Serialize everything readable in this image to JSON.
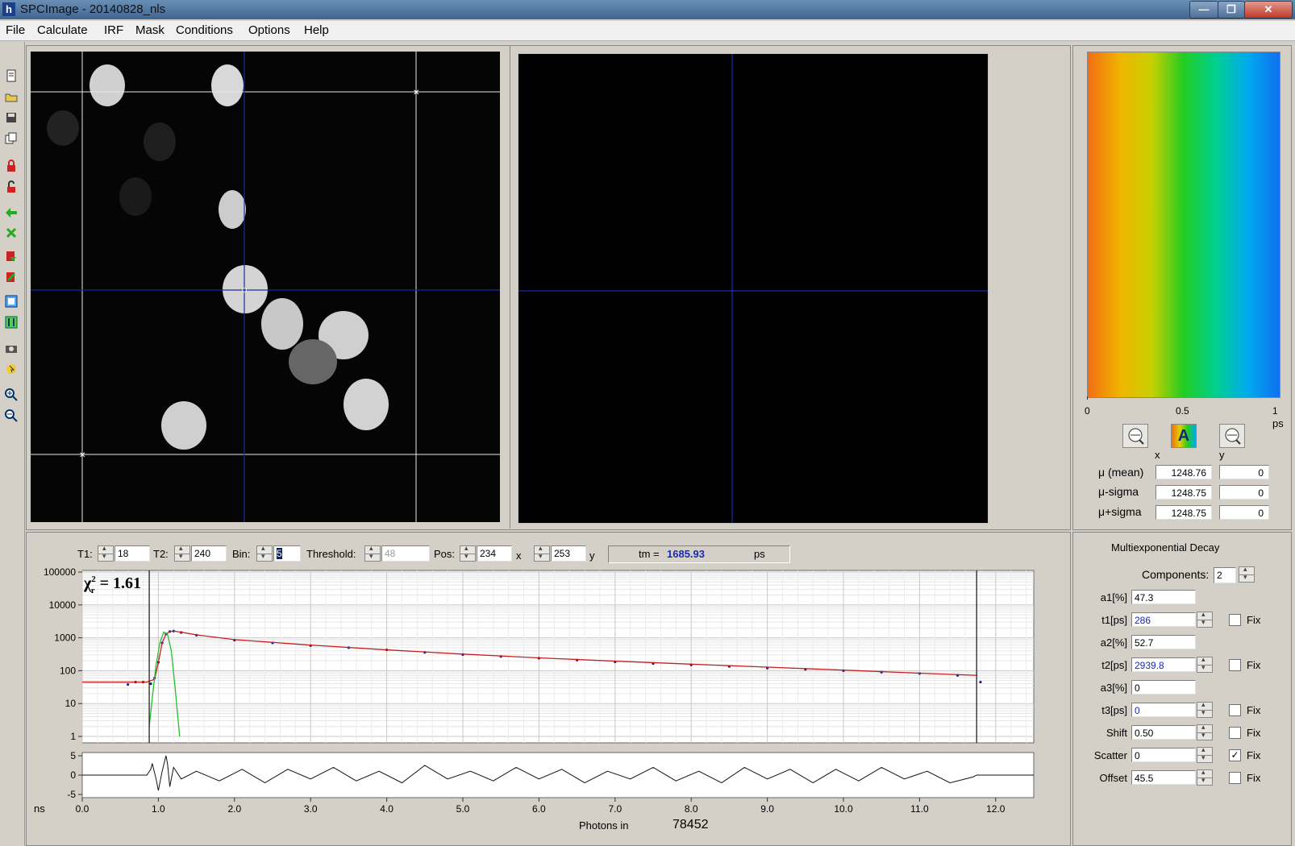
{
  "window": {
    "title": "SPCImage - 20140828_nls",
    "app_icon": "h",
    "minimize": "—",
    "maximize": "❐",
    "close": "✕"
  },
  "menu": [
    "File",
    "Calculate",
    "IRF",
    "Mask",
    "Conditions",
    "Options",
    "Help"
  ],
  "toolbar_icons": [
    "new-icon",
    "open-icon",
    "save-icon",
    "copy-icon",
    "lock-icon",
    "unlock-icon",
    "arrow-left-icon",
    "arrow-down-icon",
    "import-icon",
    "export-icon",
    "frame-icon",
    "bar-icon",
    "camera-icon",
    "pointer-icon",
    "zoom-in-icon",
    "zoom-out-icon"
  ],
  "colorbar": {
    "ticks": [
      "0",
      "0.5",
      "1"
    ],
    "unit": "ps",
    "axis_x": "x",
    "axis_y": "y",
    "auto_label": "A",
    "colors": [
      "#f06e14",
      "#f0b400",
      "#c8d000",
      "#22cc22",
      "#00d090",
      "#00aaee",
      "#1070f0"
    ]
  },
  "stats": {
    "mean_label": "μ (mean)",
    "mean_x": "1248.76",
    "mean_y": "0",
    "minus_label": "μ-sigma",
    "minus_x": "1248.75",
    "minus_y": "0",
    "plus_label": "μ+sigma",
    "plus_x": "1248.75",
    "plus_y": "0"
  },
  "controls": {
    "t1_label": "T1:",
    "t1": "18",
    "t2_label": "T2:",
    "t2": "240",
    "bin_label": "Bin:",
    "bin": "5",
    "threshold_label": "Threshold:",
    "threshold": "48",
    "pos_label": "Pos:",
    "pos_x": "234",
    "x_label": "x",
    "pos_y": "253",
    "y_label": "y",
    "tm_label": "tm =",
    "tm_value": "1685.93",
    "tm_unit": "ps"
  },
  "decay": {
    "title": "Multiexponential Decay",
    "components_label": "Components:",
    "components": "2",
    "fix_label": "Fix",
    "params": [
      {
        "label": "a1[%]",
        "value": "47.3",
        "spin": false,
        "fix": null,
        "blue": false
      },
      {
        "label": "t1[ps]",
        "value": "286",
        "spin": true,
        "fix": false,
        "blue": true
      },
      {
        "label": "a2[%]",
        "value": "52.7",
        "spin": false,
        "fix": null,
        "blue": false
      },
      {
        "label": "t2[ps]",
        "value": "2939.8",
        "spin": true,
        "fix": false,
        "blue": true
      },
      {
        "label": "a3[%]",
        "value": "0",
        "spin": false,
        "fix": null,
        "blue": false
      },
      {
        "label": "t3[ps]",
        "value": "0",
        "spin": true,
        "fix": false,
        "blue": true
      },
      {
        "label": "Shift",
        "value": "0.50",
        "spin": true,
        "fix": false,
        "blue": false
      },
      {
        "label": "Scatter",
        "value": "0",
        "spin": true,
        "fix": true,
        "blue": false
      },
      {
        "label": "Offset",
        "value": "45.5",
        "spin": true,
        "fix": false,
        "blue": false
      }
    ]
  },
  "plot": {
    "chi_text": "χ",
    "chi_sub": "r",
    "chi_sup": "2",
    "chi_value": "= 1.61",
    "y_ticks": [
      "100000",
      "10000",
      "1000",
      "100",
      "10",
      "1"
    ],
    "res_ticks": [
      "5",
      "0",
      "-5"
    ],
    "x_ticks": [
      "0.0",
      "1.0",
      "2.0",
      "3.0",
      "4.0",
      "5.0",
      "6.0",
      "7.0",
      "8.0",
      "9.0",
      "10.0",
      "11.0",
      "12.0"
    ],
    "x_unit": "ns",
    "photons_label": "Photons in",
    "photons_value": "78452"
  },
  "chart_data": {
    "type": "line",
    "xlabel": "ns",
    "xlim": [
      0,
      12.5
    ],
    "ylim": [
      1,
      100000
    ],
    "yscale": "log",
    "x_markers": [
      0.88,
      11.75
    ],
    "series": [
      {
        "role": "measured-decay",
        "color": "#1a1a8c",
        "kind": "points",
        "x": [
          0.6,
          0.7,
          0.8,
          0.9,
          0.95,
          1.0,
          1.05,
          1.1,
          1.15,
          1.2,
          1.3,
          1.5,
          2.0,
          2.5,
          3.0,
          3.5,
          4.0,
          4.5,
          5.0,
          5.5,
          6.0,
          6.5,
          7.0,
          7.5,
          8.0,
          8.5,
          9.0,
          9.5,
          10.0,
          10.5,
          11.0,
          11.5,
          11.8
        ],
        "y": [
          38,
          45,
          45,
          40,
          60,
          180,
          700,
          1300,
          1550,
          1600,
          1450,
          1200,
          850,
          700,
          580,
          500,
          430,
          360,
          310,
          270,
          240,
          210,
          185,
          165,
          150,
          135,
          120,
          110,
          100,
          90,
          82,
          72,
          45
        ]
      },
      {
        "role": "fit",
        "color": "#c81e1e",
        "kind": "line",
        "x": [
          0.0,
          0.85,
          0.95,
          1.0,
          1.05,
          1.1,
          1.15,
          1.2,
          1.3,
          1.5,
          2.0,
          3.0,
          4.0,
          5.0,
          6.0,
          7.0,
          8.0,
          9.0,
          10.0,
          11.0,
          11.75
        ],
        "y": [
          45,
          45,
          55,
          180,
          700,
          1300,
          1550,
          1600,
          1480,
          1230,
          880,
          600,
          430,
          320,
          245,
          195,
          158,
          128,
          104,
          84,
          72
        ]
      },
      {
        "role": "irf",
        "color": "#22c02a",
        "kind": "line",
        "x": [
          0.88,
          0.92,
          0.97,
          1.02,
          1.07,
          1.12,
          1.17,
          1.22,
          1.26,
          1.28
        ],
        "y": [
          2,
          15,
          150,
          700,
          1500,
          1300,
          400,
          30,
          3,
          1
        ]
      }
    ],
    "residuals": {
      "ylim": [
        -5,
        5
      ],
      "x": [
        0.0,
        0.85,
        0.9,
        0.92,
        0.97,
        1.0,
        1.05,
        1.1,
        1.12,
        1.15,
        1.2,
        1.3,
        1.5,
        1.8,
        2.1,
        2.4,
        2.7,
        3.0,
        3.3,
        3.6,
        3.9,
        4.2,
        4.5,
        4.8,
        5.1,
        5.4,
        5.7,
        6.0,
        6.3,
        6.6,
        6.9,
        7.2,
        7.5,
        7.8,
        8.1,
        8.4,
        8.7,
        9.0,
        9.3,
        9.6,
        9.9,
        10.2,
        10.5,
        10.8,
        11.1,
        11.4,
        11.7,
        11.75,
        12.5
      ],
      "y": [
        0,
        0,
        1.5,
        3,
        -1,
        -4,
        1,
        5,
        3,
        -3,
        2,
        -1,
        1,
        -1.5,
        1.5,
        -2,
        1.5,
        -1,
        2,
        -1.5,
        1,
        -2,
        2.5,
        -1,
        1,
        -1.5,
        2,
        -1,
        1.5,
        -2,
        1,
        -1,
        2,
        -1.5,
        1,
        -2,
        2,
        -1,
        1.5,
        -2,
        1.5,
        -1.5,
        2,
        -1,
        1,
        -2,
        -0.5,
        0,
        0
      ]
    }
  }
}
